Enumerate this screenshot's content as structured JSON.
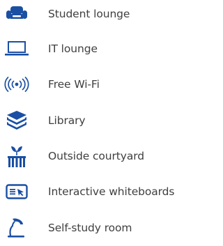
{
  "accent_color": "#1a4fa3",
  "amenities": [
    {
      "label": "Student lounge",
      "icon": "sofa-icon"
    },
    {
      "label": "IT lounge",
      "icon": "laptop-icon"
    },
    {
      "label": "Free Wi-Fi",
      "icon": "wifi-icon"
    },
    {
      "label": "Library",
      "icon": "books-icon"
    },
    {
      "label": "Outside courtyard",
      "icon": "courtyard-icon"
    },
    {
      "label": "Interactive whiteboards",
      "icon": "whiteboard-icon"
    },
    {
      "label": "Self-study room",
      "icon": "desk-lamp-icon"
    }
  ]
}
